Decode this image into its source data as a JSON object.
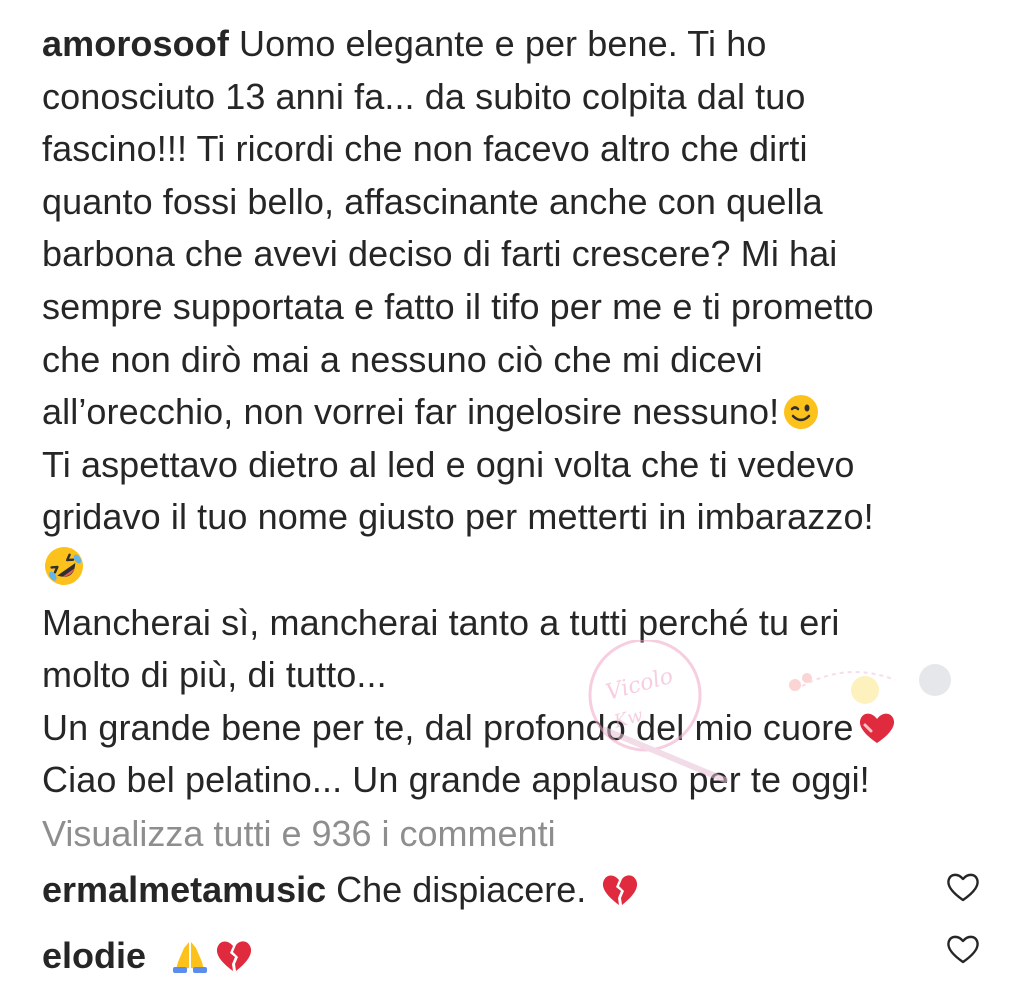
{
  "caption": {
    "username": "amorosoof",
    "lines": [
      "Uomo elegante e per bene. Ti ho",
      "conosciuto 13 anni fa... da subito colpita dal tuo",
      "fascino!!! Ti ricordi che non facevo altro che dirti",
      "quanto fossi bello, affascinante anche con quella",
      "barbona che avevi deciso di farti crescere? Mi hai",
      "sempre supportata e fatto il tifo per me e ti prometto",
      "che non dirò mai a nessuno ciò che mi dicevi",
      "all’orecchio, non vorrei far ingelosire nessuno!",
      "Ti aspettavo dietro al led e ogni volta che ti vedevo",
      "gridavo il tuo nome giusto per metterti in imbarazzo!",
      "",
      "Mancherai sì, mancherai tanto a tutti perché tu eri",
      "molto di più, di tutto...",
      "Un grande bene per te, dal profondo del mio cuore",
      "Ciao bel pelatino... Un grande applauso per te oggi!"
    ],
    "emojis": {
      "wink": "winking-face-emoji",
      "laugh": "rolling-on-floor-laughing-emoji",
      "heart": "mending-heart-emoji"
    }
  },
  "view_all_comments": "Visualizza tutti e 936 i commenti",
  "comments": [
    {
      "username": "ermalmetamusic",
      "text": "Che dispiacere.",
      "emojis": [
        "broken-heart-emoji"
      ]
    },
    {
      "username": "elodie",
      "text": "",
      "emojis": [
        "folded-hands-emoji",
        "broken-heart-emoji"
      ]
    }
  ],
  "colors": {
    "text": "#262626",
    "secondary": "#8e8e8e",
    "heart_red": "#e02a3d",
    "emoji_yellow": "#fcc21b"
  }
}
